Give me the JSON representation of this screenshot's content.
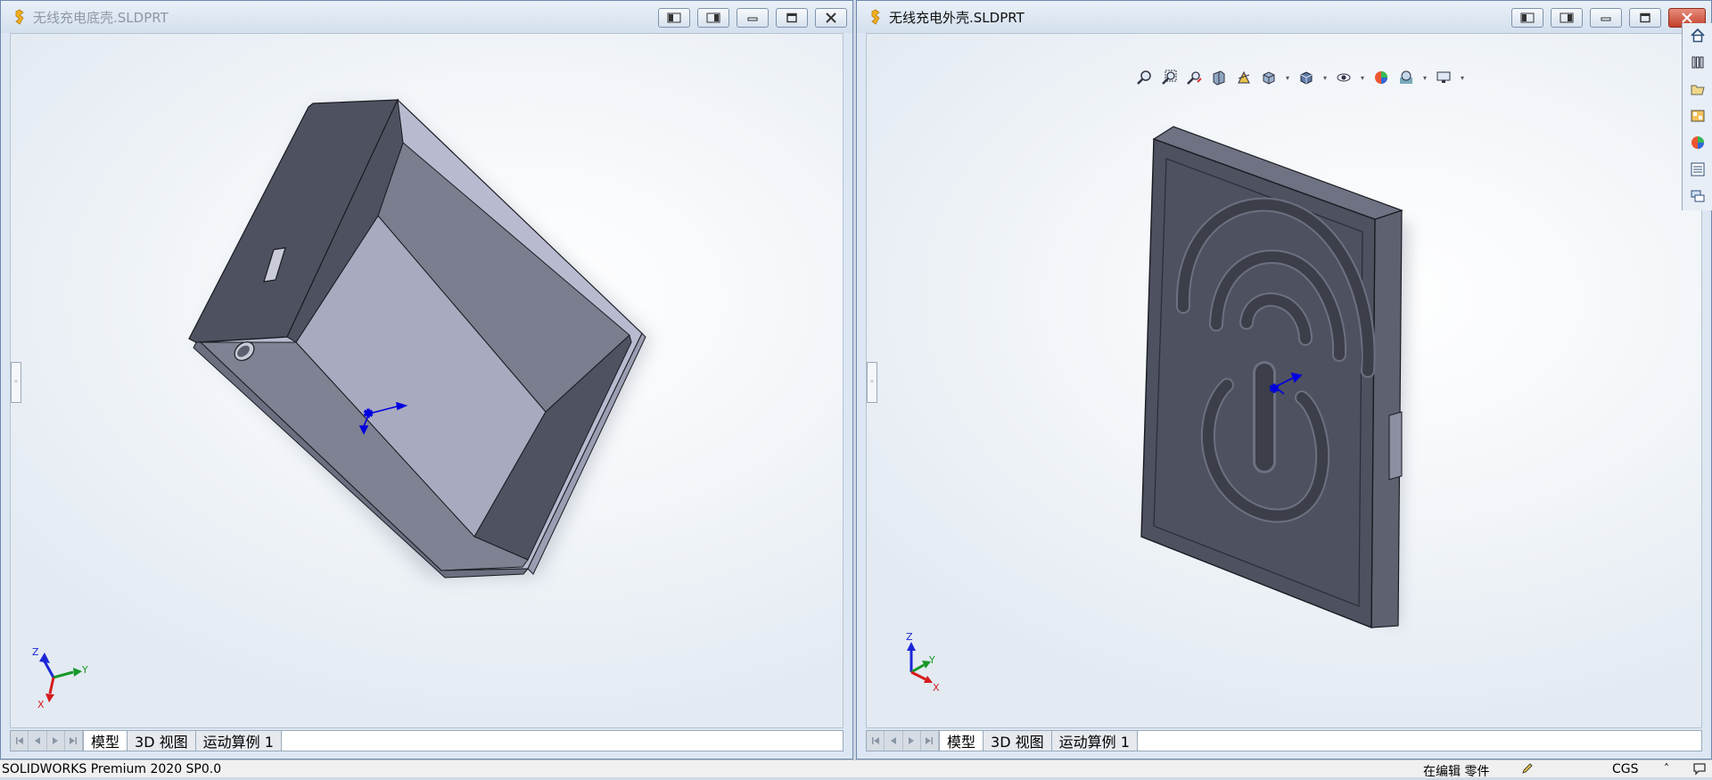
{
  "windows": {
    "left": {
      "title": "无线充电底壳.SLDPRT",
      "tabs": [
        {
          "label": "模型"
        },
        {
          "label": "3D 视图"
        },
        {
          "label": "运动算例 1"
        }
      ],
      "triad": {
        "z": "Z",
        "y": "Y",
        "x": "X"
      }
    },
    "right": {
      "title": "无线充电外壳.SLDPRT",
      "tabs": [
        {
          "label": "模型"
        },
        {
          "label": "3D 视图"
        },
        {
          "label": "运动算例 1"
        }
      ],
      "triad": {
        "z": "Z",
        "y": "Y",
        "x": "X"
      }
    }
  },
  "heads_up_toolbar": [
    "zoom-to-fit-icon",
    "zoom-to-area-icon",
    "previous-view-icon",
    "section-view-icon",
    "dynamic-annotation-icon",
    "view-orientation-icon",
    "display-style-icon",
    "hide-show-items-icon",
    "edit-appearance-icon",
    "apply-scene-icon",
    "view-settings-icon"
  ],
  "task_pane": [
    "home-icon",
    "design-library-icon",
    "file-explorer-icon",
    "view-palette-icon",
    "appearances-icon",
    "custom-properties-icon",
    "forum-icon"
  ],
  "status_bar": {
    "product": "SOLIDWORKS Premium 2020 SP0.0",
    "mode": "在编辑 零件",
    "units": "CGS",
    "up_arrow": "˄"
  },
  "colors": {
    "titlebar": "#dbe5f1",
    "viewport_top": "#ffffff",
    "part_dark": "#4e5160",
    "part_mid": "#7b7e8e",
    "part_light": "#a9abbf",
    "close_red": "#c8432f"
  }
}
